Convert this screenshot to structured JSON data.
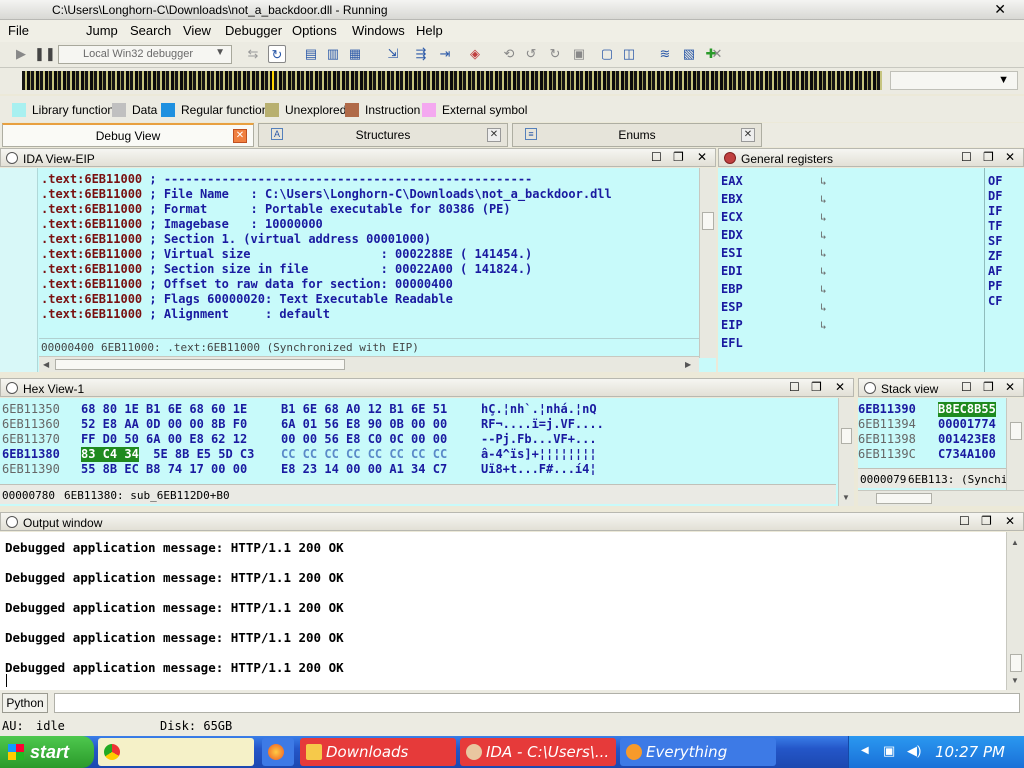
{
  "window": {
    "title": "C:\\Users\\Longhorn-C\\Downloads\\not_a_backdoor.dll - Running"
  },
  "menu": [
    "File",
    "Jump",
    "Search",
    "View",
    "Debugger",
    "Options",
    "Windows",
    "Help"
  ],
  "toolbar": {
    "debugger_select": "Local Win32 debugger"
  },
  "legend": [
    {
      "label": "Library function",
      "color": "#a8f0f0"
    },
    {
      "label": "Data",
      "color": "#c0c0c0"
    },
    {
      "label": "Regular function",
      "color": "#1e90e0"
    },
    {
      "label": "Unexplored",
      "color": "#b8b070"
    },
    {
      "label": "Instruction",
      "color": "#b06a48"
    },
    {
      "label": "External symbol",
      "color": "#f4a8f0"
    }
  ],
  "tabs": [
    {
      "label": "Debug View",
      "icon": "debug-icon"
    },
    {
      "label": "Structures",
      "icon": "structures-icon"
    },
    {
      "label": "Enums",
      "icon": "enums-icon"
    }
  ],
  "ida_view": {
    "title": "IDA View-EIP",
    "lines": [
      {
        "addr": ".text:6EB11000",
        "text": " ; ---------------------------------------------------"
      },
      {
        "addr": ".text:6EB11000",
        "text": " ; File Name   : C:\\Users\\Longhorn-C\\Downloads\\not_a_backdoor.dll"
      },
      {
        "addr": ".text:6EB11000",
        "text": " ; Format      : Portable executable for 80386 (PE)"
      },
      {
        "addr": ".text:6EB11000",
        "text": " ; Imagebase   : 10000000"
      },
      {
        "addr": ".text:6EB11000",
        "text": " ; Section 1. (virtual address 00001000)"
      },
      {
        "addr": ".text:6EB11000",
        "text": " ; Virtual size                  : 0002288E ( 141454.)"
      },
      {
        "addr": ".text:6EB11000",
        "text": " ; Section size in file          : 00022A00 ( 141824.)"
      },
      {
        "addr": ".text:6EB11000",
        "text": " ; Offset to raw data for section: 00000400"
      },
      {
        "addr": ".text:6EB11000",
        "text": " ; Flags 60000020: Text Executable Readable"
      },
      {
        "addr": ".text:6EB11000",
        "text": " ; Alignment     : default"
      }
    ],
    "status_offset": "00000400",
    "status_text": "6EB11000: .text:6EB11000 (Synchronized with EIP)"
  },
  "registers": {
    "title": "General registers",
    "names": [
      "EAX",
      "EBX",
      "ECX",
      "EDX",
      "ESI",
      "EDI",
      "EBP",
      "ESP",
      "EIP",
      "EFL"
    ],
    "flags": [
      "OF",
      "DF",
      "IF",
      "TF",
      "SF",
      "ZF",
      "AF",
      "PF",
      "CF"
    ]
  },
  "hex_view": {
    "title": "Hex View-1",
    "rows": [
      {
        "addr": "6EB11350",
        "a": "68 80 1E B1 6E 68 60 1E",
        "b": "B1 6E 68 A0 12 B1 6E 51",
        "ascii": "hÇ.¦nh`.¦nhá.¦nQ"
      },
      {
        "addr": "6EB11360",
        "a": "52 E8 AA 0D 00 00 8B F0",
        "b": "6A 01 56 E8 90 0B 00 00",
        "ascii": "RF¬....ï=j.VF...."
      },
      {
        "addr": "6EB11370",
        "a": "FF D0 50 6A 00 E8 62 12",
        "b": "00 00 56 E8 C0 0C 00 00",
        "ascii": "--Pj.Fb...VF+..."
      },
      {
        "addr": "6EB11380",
        "hl": "83 C4 34",
        "a": " 5E 8B E5 5D C3",
        "b": "CC CC CC CC CC CC CC CC",
        "ascii": "â-4^ïs]+¦¦¦¦¦¦¦¦"
      },
      {
        "addr": "6EB11390",
        "a": "55 8B EC B8 74 17 00 00",
        "b": "E8 23 14 00 00 A1 34 C7",
        "ascii": "Uï8+t...F#...í4¦"
      }
    ],
    "status_offset": "00000780",
    "status_text": "6EB11380: sub_6EB112D0+B0"
  },
  "stack_view": {
    "title": "Stack view",
    "rows": [
      {
        "addr": "6EB11390",
        "val": "B8EC8B55"
      },
      {
        "addr": "6EB11394",
        "val": "00001774"
      },
      {
        "addr": "6EB11398",
        "val": "001423E8"
      },
      {
        "addr": "6EB1139C",
        "val": "C734A100"
      }
    ],
    "status_offset": "0000079",
    "status_text": "6EB113: (Synchi"
  },
  "output": {
    "title": "Output window",
    "lines": [
      "Debugged application message: HTTP/1.1 200 OK",
      "Debugged application message: HTTP/1.1 200 OK",
      "Debugged application message: HTTP/1.1 200 OK",
      "Debugged application message: HTTP/1.1 200 OK",
      "Debugged application message: HTTP/1.1 200 OK"
    ]
  },
  "python_button": "Python",
  "status": {
    "au_label": "AU:",
    "au_state": "idle",
    "disk": "Disk: 65GB"
  },
  "taskbar": {
    "start": "start",
    "items": [
      {
        "label": "",
        "icon": "chrome-icon",
        "bg": "#f5f1c8"
      },
      {
        "label": "",
        "icon": "firefox-icon",
        "bg": "#3d7ae6"
      },
      {
        "label": "Downloads",
        "icon": "folder-icon",
        "bg": "#e63a3a"
      },
      {
        "label": "IDA - C:\\Users\\...",
        "icon": "ida-icon",
        "bg": "#e63a3a"
      },
      {
        "label": "Everything",
        "icon": "search-icon",
        "bg": "#3d7ae6"
      }
    ],
    "clock": "10:27 PM"
  }
}
